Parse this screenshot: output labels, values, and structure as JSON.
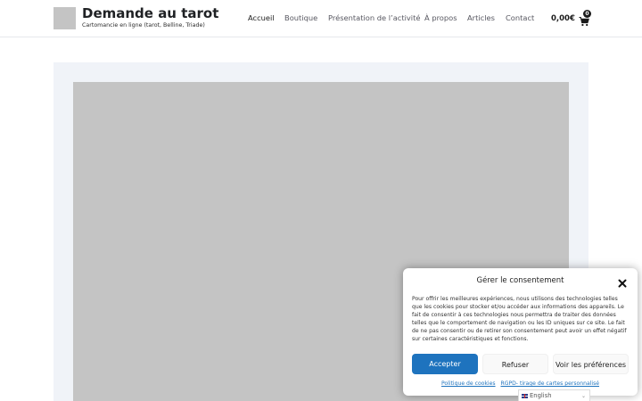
{
  "site": {
    "title": "Demande au tarot",
    "tagline": "Cartomancie en ligne (tarot, Belline, Triade)"
  },
  "nav": {
    "items": [
      {
        "label": "Accueil",
        "active": true
      },
      {
        "label": "Boutique",
        "active": false
      },
      {
        "label": "Présentation de l’activité",
        "active": false
      },
      {
        "label": "À propos",
        "active": false
      },
      {
        "label": "Articles",
        "active": false
      },
      {
        "label": "Contact",
        "active": false
      }
    ]
  },
  "cart": {
    "amount": "0,00€",
    "count": "0",
    "icon": "shopping-cart-icon"
  },
  "consent": {
    "title": "Gérer le consentement",
    "text": "Pour offrir les meilleures expériences, nous utilisons des technologies telles que les cookies pour stocker et/ou accéder aux informations des appareils. Le fait de consentir à ces technologies nous permettra de traiter des données telles que le comportement de navigation ou les ID uniques sur ce site. Le fait de ne pas consentir ou de retirer son consentement peut avoir un effet négatif sur certaines caractéristiques et fonctions.",
    "accept_label": "Accepter",
    "refuse_label": "Refuser",
    "prefs_label": "Voir les préférences",
    "links": {
      "cookies": "Politique de cookies",
      "rgpd": "RGPD- tirage de cartes personnalisé"
    },
    "close_icon": "close-icon"
  },
  "language": {
    "label": "English",
    "icon": "flag-en-icon"
  },
  "colors": {
    "accent": "#1e73be",
    "placeholder": "#c4c4c4",
    "frame": "#f0f3f8"
  }
}
